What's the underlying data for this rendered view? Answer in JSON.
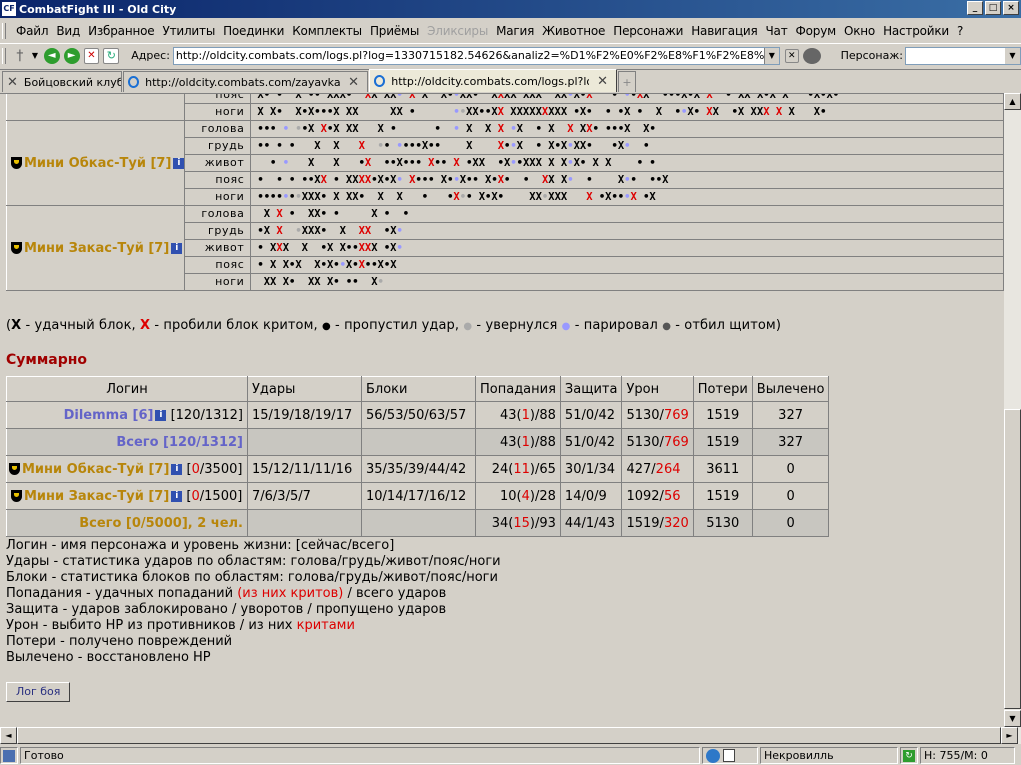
{
  "window": {
    "title": "CombatFight III - Old City",
    "app_icon": "CF"
  },
  "menu": [
    "Файл",
    "Вид",
    "Избранное",
    "Утилиты",
    "Поединки",
    "Комплекты",
    "Приёмы",
    "Эликсиры",
    "Магия",
    "Животное",
    "Персонажи",
    "Навигация",
    "Чат",
    "Форум",
    "Окно",
    "Настройки",
    "?"
  ],
  "menu_disabled": "Эликсиры",
  "toolbar": {
    "address_label": "Адрес:",
    "address": "http://oldcity.combats.com/logs.pl?log=1330715182.54626&analiz2=%D1%F2%E0%F2%E8%F1%F2%E8%EA%E0",
    "character_label": "Персонаж:",
    "character_value": ""
  },
  "tabs": [
    {
      "label": "Бойцовский клуб",
      "active": false
    },
    {
      "label": "http://oldcity.combats.com/zayavka.pl...",
      "active": false
    },
    {
      "label": "http://oldcity.combats.com/logs.pl?log...",
      "active": true
    }
  ],
  "zones": [
    "голова",
    "грудь",
    "живот",
    "пояс",
    "ноги"
  ],
  "partial_zones": [
    "пояс",
    "ноги"
  ],
  "players": [
    {
      "name": "Мини Обкас-Туй [7]"
    },
    {
      "name": "Мини Закас-Туй [7]"
    }
  ],
  "legend": {
    "x_label": "X",
    "x_text": " - удачный блок, ",
    "xc_label": "X",
    "xc_text": " - пробили блок критом, ",
    "dot_text": " - пропустил удар, ",
    "dodge_text": " - увернулся ",
    "parry_text": " - парировал ",
    "shield_text": " - отбил щитом)",
    "open": "(",
    "dot_glyph": "●"
  },
  "summary": {
    "title": "Суммарно",
    "headers": [
      "Логин",
      "Удары",
      "Блоки",
      "Попадания",
      "Защита",
      "Урон",
      "Потери",
      "Вылечено"
    ],
    "rows": [
      {
        "name": "Dilemma [6]",
        "hp": "[120/1312]",
        "hits": "15/19/18/19/17",
        "blocks": "56/53/50/63/57",
        "pop_a": "43(",
        "pop_crit": "1",
        "pop_b": ")/88",
        "def": "51/0/42",
        "dmg_a": "5130/",
        "dmg_crit": "769",
        "loss": "1519",
        "healed": "327"
      },
      {
        "total": "Всего [120/1312]",
        "pop_a": "43(",
        "pop_crit": "1",
        "pop_b": ")/88",
        "def": "51/0/42",
        "dmg_a": "5130/",
        "dmg_crit": "769",
        "loss": "1519",
        "healed": "327"
      },
      {
        "name": "Мини Обкас-Туй [7]",
        "hp_a": " [",
        "hp_cur": "0",
        "hp_b": "/3500]",
        "hits": "15/12/11/11/16",
        "blocks": "35/35/39/44/42",
        "pop_a": "24(",
        "pop_crit": "11",
        "pop_b": ")/65",
        "def": "30/1/34",
        "dmg_a": "427/",
        "dmg_crit": "264",
        "loss": "3611",
        "healed": "0"
      },
      {
        "name": "Мини Закас-Туй [7]",
        "hp_a": " [",
        "hp_cur": "0",
        "hp_b": "/1500]",
        "hits": "7/6/3/5/7",
        "blocks": "10/14/17/16/12",
        "pop_a": "10(",
        "pop_crit": "4",
        "pop_b": ")/28",
        "def": "14/0/9",
        "dmg_a": "1092/",
        "dmg_crit": "56",
        "loss": "1519",
        "healed": "0"
      },
      {
        "total": "Всего [0/5000], 2 чел.",
        "pop_a": "34(",
        "pop_crit": "15",
        "pop_b": ")/93",
        "def": "44/1/43",
        "dmg_a": "1519/",
        "dmg_crit": "320",
        "loss": "5130",
        "healed": "0"
      }
    ]
  },
  "notes": {
    "n1": "Логин - имя персонажа и уровень жизни: [сейчас/всего]",
    "n2": "Удары - статистика ударов по областям: голова/грудь/живот/пояс/ноги",
    "n3": "Блоки - статистика блоков по областям: голова/грудь/живот/пояс/ноги",
    "n4a": "Попадания - удачных попаданий ",
    "n4b": "(из них критов)",
    "n4c": " / всего ударов",
    "n5": "Защита - ударов заблокировано / уворотов / пропущено ударов",
    "n6": "Урон - выбито HP из противников / из них ",
    "n6b": "критами",
    "n7": "Потери - получено повреждений",
    "n8": "Вылечено - восстановлено HP"
  },
  "log_button": "Лог боя",
  "status": {
    "text": "Готово",
    "location": "Некровилль",
    "hp": "H: 755/M: 0"
  }
}
